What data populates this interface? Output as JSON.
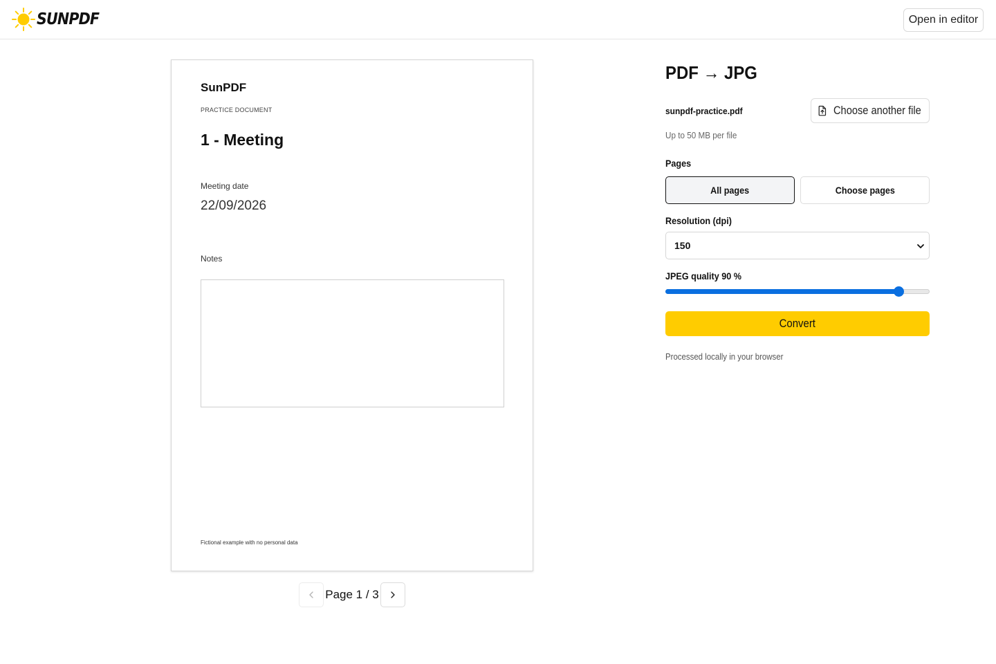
{
  "header": {
    "brand": "SUNPDF",
    "open_editor_label": "Open in editor"
  },
  "preview": {
    "doc_brand": "SunPDF",
    "doc_kicker": "PRACTICE DOCUMENT",
    "doc_title": "1 - Meeting",
    "date_label": "Meeting date",
    "date_value": "22/09/2026",
    "notes_label": "Notes",
    "footer": "Fictional example with no personal data",
    "pager": {
      "label": "Page 1 / 3",
      "current": 1,
      "total": 3
    }
  },
  "tool": {
    "title": "PDF → JPG",
    "file_name": "sunpdf-practice.pdf",
    "choose_file_label": "Choose another file",
    "file_limit": "Up to 50 MB per file",
    "pages_label": "Pages",
    "pages_options": [
      "All pages",
      "Choose pages"
    ],
    "pages_selected": "All pages",
    "resolution_label": "Resolution (dpi)",
    "resolution_value": "150",
    "quality_label": "JPEG quality 90 %",
    "quality_value": 90,
    "convert_label": "Convert",
    "local_note": "Processed locally in your browser"
  },
  "colors": {
    "accent": "#ffcc00",
    "slider": "#0a6fe0",
    "sun": "#ffcc00"
  },
  "icons": {
    "logo": "sun-icon",
    "choose_file": "file-upload-icon",
    "prev": "chevron-left-icon",
    "next": "chevron-right-icon",
    "select": "chevron-down-icon"
  }
}
